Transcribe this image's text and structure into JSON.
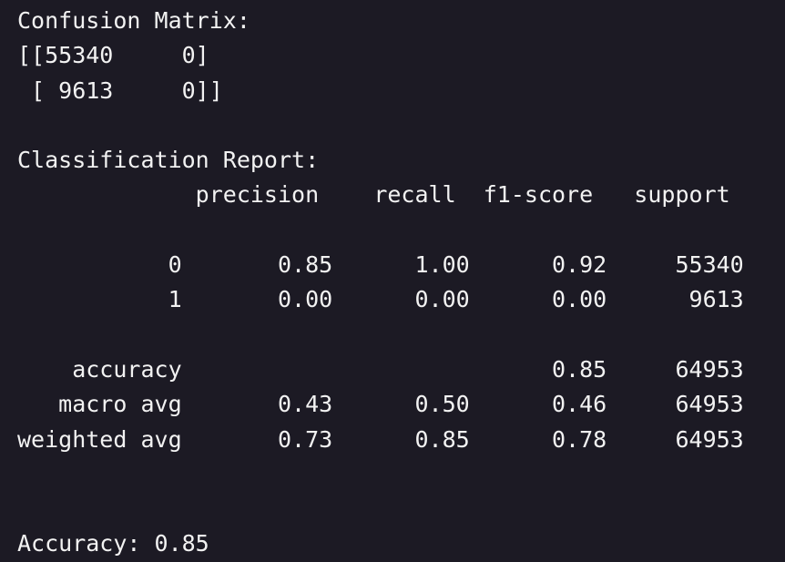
{
  "output": {
    "lines": [
      "Confusion Matrix:",
      "[[55340     0]",
      " [ 9613     0]]",
      "",
      "Classification Report:",
      "             precision    recall  f1-score   support",
      "",
      "           0       0.85      1.00      0.92     55340",
      "           1       0.00      0.00      0.00      9613",
      "",
      "    accuracy                           0.85     64953",
      "   macro avg       0.43      0.50      0.46     64953",
      "weighted avg       0.73      0.85      0.78     64953",
      "",
      "",
      "Accuracy: 0.85"
    ]
  },
  "colors": {
    "background": "#1c1a24",
    "text": "#f2f2f2"
  }
}
